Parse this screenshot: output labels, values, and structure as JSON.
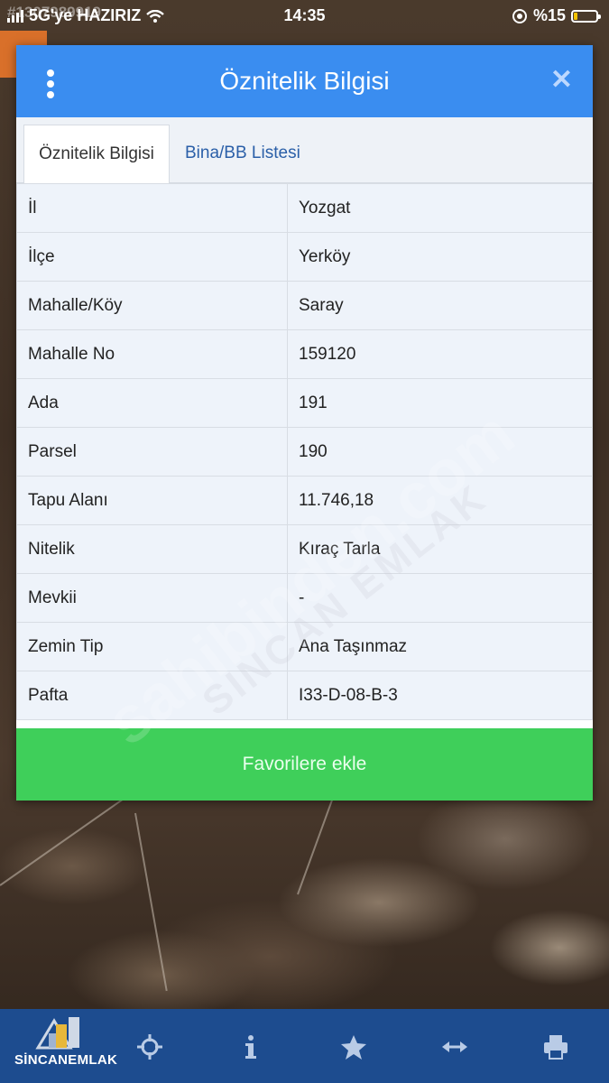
{
  "status_bar": {
    "carrier": "5G'ye HAZIRIZ",
    "time": "14:35",
    "battery": "%15",
    "battery_level": 0.15,
    "overlay_number": "#1307989919"
  },
  "modal": {
    "title": "Öznitelik Bilgisi",
    "tabs": [
      {
        "label": "Öznitelik Bilgisi",
        "active": true
      },
      {
        "label": "Bina/BB Listesi",
        "active": false
      }
    ],
    "rows": [
      {
        "key": "İl",
        "value": "Yozgat"
      },
      {
        "key": "İlçe",
        "value": "Yerköy"
      },
      {
        "key": "Mahalle/Köy",
        "value": "Saray"
      },
      {
        "key": "Mahalle No",
        "value": "159120"
      },
      {
        "key": "Ada",
        "value": "191"
      },
      {
        "key": "Parsel",
        "value": "190"
      },
      {
        "key": "Tapu Alanı",
        "value": "11.746,18"
      },
      {
        "key": "Nitelik",
        "value": "Kıraç Tarla"
      },
      {
        "key": "Mevkii",
        "value": "-"
      },
      {
        "key": "Zemin Tip",
        "value": "Ana Taşınmaz"
      },
      {
        "key": "Pafta",
        "value": "I33-D-08-B-3"
      }
    ],
    "favorite_button": "Favorilere ekle"
  },
  "watermark": {
    "site": "sahibinden.com",
    "agency": "SINCAN EMLAK"
  },
  "toolbar": {
    "logo_text": "SİNCANEMLAK",
    "icons": [
      "crosshair-icon",
      "info-icon",
      "star-icon",
      "measure-icon",
      "print-icon"
    ]
  },
  "colors": {
    "header": "#3a8df0",
    "favorite": "#3fcf5a",
    "toolbar": "#1d4c8f"
  }
}
